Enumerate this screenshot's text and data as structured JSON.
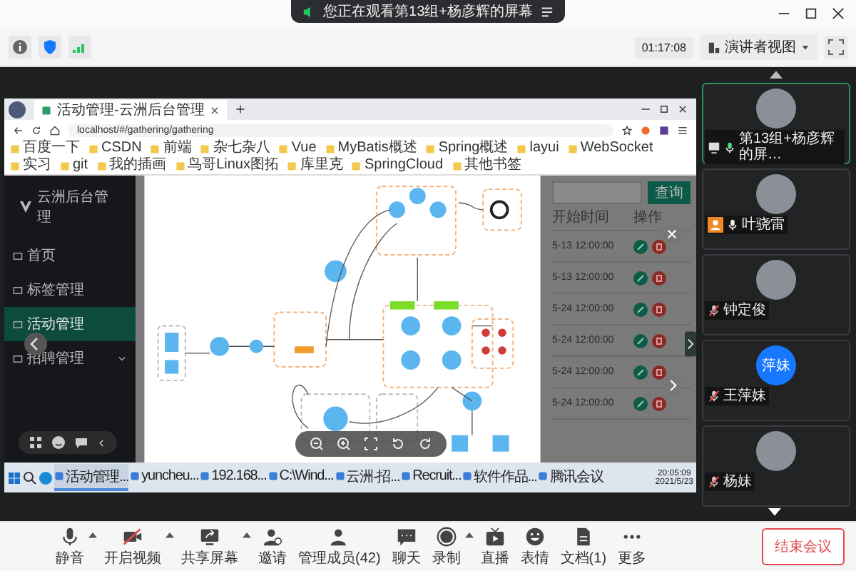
{
  "banner": {
    "text": "您正在观看第13组+杨彦辉的屏幕"
  },
  "timer": "01:17:08",
  "view_button": "演讲者视图",
  "shared_screen": {
    "browser": {
      "tab_title": "活动管理-云洲后台管理",
      "url": "localhost/#/gathering/gathering",
      "bookmarks": [
        "百度一下",
        "CSDN",
        "前端",
        "杂七杂八",
        "Vue",
        "MyBatis概述",
        "Spring概述",
        "layui",
        "WebSocket",
        "实习",
        "git",
        "我的插画",
        "鸟哥Linux图拓",
        "库里克",
        "SpringCloud",
        "其他书签"
      ]
    },
    "app": {
      "logo": "云洲后台管理",
      "menu": [
        {
          "label": "首页",
          "selected": false,
          "has_submenu": false
        },
        {
          "label": "标签管理",
          "selected": false,
          "has_submenu": false
        },
        {
          "label": "活动管理",
          "selected": true,
          "has_submenu": false
        },
        {
          "label": "招聘管理",
          "selected": false,
          "has_submenu": true
        }
      ],
      "search_button": "查询",
      "columns": [
        "开始时间",
        "操作"
      ],
      "rows": [
        {
          "start_time": "5-13 12:00:00"
        },
        {
          "start_time": "5-13 12:00:00"
        },
        {
          "start_time": "5-24 12:00:00"
        },
        {
          "start_time": "5-24 12:00:00"
        },
        {
          "start_time": "5-24 12:00:00"
        },
        {
          "start_time": "5-24 12:00:00"
        }
      ]
    },
    "taskbar": {
      "apps": [
        {
          "label": "活动管理...",
          "selected": true
        },
        {
          "label": "yuncheu...",
          "selected": false
        },
        {
          "label": "192.168...",
          "selected": false
        },
        {
          "label": "C:\\Wind...",
          "selected": false
        },
        {
          "label": "云洲-招...",
          "selected": false
        },
        {
          "label": "Recruit...",
          "selected": false
        },
        {
          "label": "软件作品...",
          "selected": false
        },
        {
          "label": "腾讯会议",
          "selected": false
        }
      ],
      "time": "20:05:09",
      "date": "2021/5/23"
    }
  },
  "participants": [
    {
      "name": "第13组+杨彦辉的屏…",
      "muted": false,
      "speaking": true,
      "host": false,
      "sharing": true
    },
    {
      "name": "叶骁雷",
      "muted": false,
      "speaking": false,
      "host": true,
      "sharing": false
    },
    {
      "name": "钟定俊",
      "muted": true,
      "speaking": false,
      "host": false,
      "sharing": false
    },
    {
      "name": "王萍妹",
      "muted": true,
      "speaking": false,
      "host": false,
      "sharing": false,
      "avatar_text": "萍妹"
    },
    {
      "name": "杨妹",
      "muted": true,
      "speaking": false,
      "host": false,
      "sharing": false
    }
  ],
  "toolbar": [
    {
      "label": "静音",
      "kind": "mic",
      "caret": true
    },
    {
      "label": "开启视频",
      "kind": "video_off",
      "caret": true
    },
    {
      "label": "共享屏幕",
      "kind": "share",
      "caret": true
    },
    {
      "label": "邀请",
      "kind": "invite",
      "caret": false
    },
    {
      "label": "管理成员(42)",
      "kind": "members",
      "caret": false
    },
    {
      "label": "聊天",
      "kind": "chat",
      "caret": false
    },
    {
      "label": "录制",
      "kind": "record",
      "caret": true
    },
    {
      "label": "直播",
      "kind": "live",
      "caret": false
    },
    {
      "label": "表情",
      "kind": "emoji",
      "caret": false
    },
    {
      "label": "文档(1)",
      "kind": "doc",
      "caret": false
    },
    {
      "label": "更多",
      "kind": "more",
      "caret": false
    }
  ],
  "end_button": "结束会议"
}
